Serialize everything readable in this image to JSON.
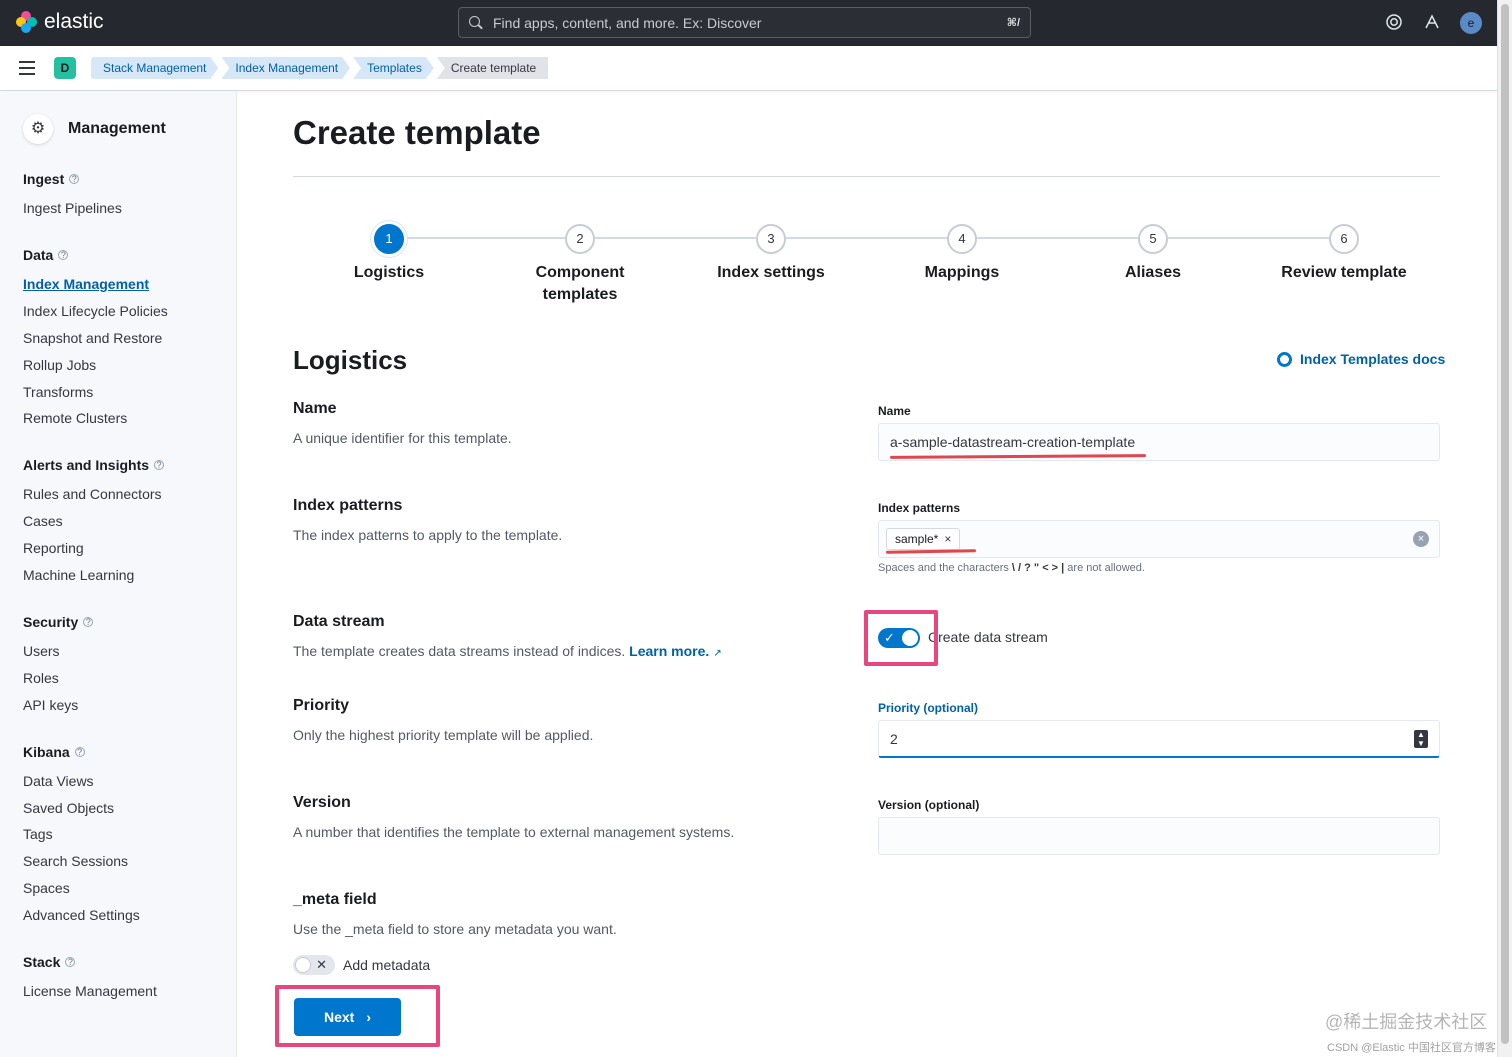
{
  "header": {
    "brand": "elastic",
    "search_placeholder": "Find apps, content, and more. Ex: Discover",
    "search_shortcut": "⌘/",
    "user_initial": "e"
  },
  "breadcrumb": {
    "space_initial": "D",
    "items": [
      "Stack Management",
      "Index Management",
      "Templates",
      "Create template"
    ]
  },
  "sidebar": {
    "title": "Management",
    "groups": [
      {
        "title": "Ingest",
        "items": [
          "Ingest Pipelines"
        ]
      },
      {
        "title": "Data",
        "items": [
          "Index Management",
          "Index Lifecycle Policies",
          "Snapshot and Restore",
          "Rollup Jobs",
          "Transforms",
          "Remote Clusters"
        ]
      },
      {
        "title": "Alerts and Insights",
        "items": [
          "Rules and Connectors",
          "Cases",
          "Reporting",
          "Machine Learning"
        ]
      },
      {
        "title": "Security",
        "items": [
          "Users",
          "Roles",
          "API keys"
        ]
      },
      {
        "title": "Kibana",
        "items": [
          "Data Views",
          "Saved Objects",
          "Tags",
          "Search Sessions",
          "Spaces",
          "Advanced Settings"
        ]
      },
      {
        "title": "Stack",
        "items": [
          "License Management"
        ]
      }
    ],
    "active_item": "Index Management"
  },
  "page": {
    "title": "Create template",
    "steps": [
      {
        "number": "1",
        "label": "Logistics",
        "active": true
      },
      {
        "number": "2",
        "label": "Component templates",
        "active": false
      },
      {
        "number": "3",
        "label": "Index settings",
        "active": false
      },
      {
        "number": "4",
        "label": "Mappings",
        "active": false
      },
      {
        "number": "5",
        "label": "Aliases",
        "active": false
      },
      {
        "number": "6",
        "label": "Review template",
        "active": false
      }
    ],
    "section_title": "Logistics",
    "docs_link": "Index Templates docs"
  },
  "form": {
    "name": {
      "title": "Name",
      "desc": "A unique identifier for this template.",
      "label": "Name",
      "value": "a-sample-datastream-creation-template"
    },
    "index_patterns": {
      "title": "Index patterns",
      "desc": "The index patterns to apply to the template.",
      "label": "Index patterns",
      "chip": "sample*",
      "help_prefix": "Spaces and the characters",
      "help_chars": "\\ / ? \" < > |",
      "help_suffix": "are not allowed."
    },
    "data_stream": {
      "title": "Data stream",
      "desc": "The template creates data streams instead of indices.",
      "learn_more": "Learn more.",
      "toggle_label": "Create data stream",
      "enabled": true
    },
    "priority": {
      "title": "Priority",
      "desc": "Only the highest priority template will be applied.",
      "label": "Priority (optional)",
      "value": "2"
    },
    "version": {
      "title": "Version",
      "desc": "A number that identifies the template to external management systems.",
      "label": "Version (optional)",
      "value": ""
    },
    "meta": {
      "title": "_meta field",
      "desc": "Use the _meta field to store any metadata you want.",
      "toggle_label": "Add metadata",
      "enabled": false
    },
    "next_label": "Next"
  },
  "watermark": {
    "main": "@稀土掘金技术社区",
    "sub": "CSDN @Elastic 中国社区官方博客"
  },
  "colors": {
    "primary": "#0077cc",
    "header_bg": "#25282f",
    "highlight": "#e7467f",
    "annotation_underline": "#e0464e"
  }
}
